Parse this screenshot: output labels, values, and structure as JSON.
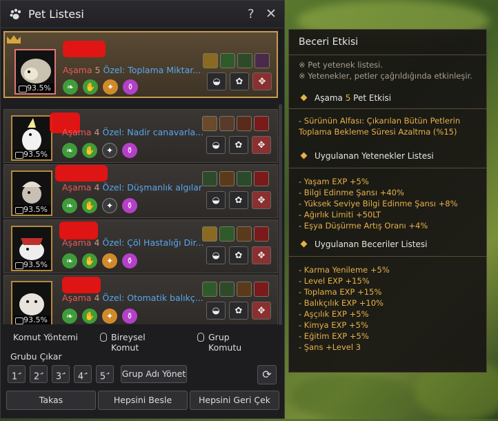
{
  "window": {
    "title": "Pet Listesi",
    "help": "?",
    "close": "✕"
  },
  "pets": [
    {
      "stage": "Aşama",
      "stage_num": "5",
      "special": "Özel: Toplama Miktar...",
      "percent": "93.5%"
    },
    {
      "stage": "Aşama",
      "stage_num": "4",
      "special": "Özel: Nadir canavarla...",
      "percent": "93.5%"
    },
    {
      "stage": "Aşama",
      "stage_num": "4",
      "special": "Özel: Düşmanlık algılar",
      "percent": "93.5%"
    },
    {
      "stage": "Aşama",
      "stage_num": "4",
      "special": "Özel: Çöl Hastalığı Dir...",
      "percent": "93.5%"
    },
    {
      "stage": "Aşama",
      "stage_num": "4",
      "special": "Özel: Otomatik balıkç...",
      "percent": "93.5%"
    }
  ],
  "footer": {
    "command_method": "Komut Yöntemi",
    "individual_command": "Bireysel Komut",
    "group_command": "Grup Komutu",
    "group_unsummon": "Grubu Çıkar",
    "group_numbers": [
      "1",
      "2",
      "3",
      "4",
      "5"
    ],
    "group_manage": "Grup Adı Yönet",
    "exchange": "Takas",
    "feed_all": "Hepsini Besle",
    "recall_all": "Hepsini Geri Çek"
  },
  "tooltip": {
    "title": "Beceri Etkisi",
    "note1": "※ Pet yetenek listesi.",
    "note2": "※ Yetenekler, petler çağrıldığında etkinleşir.",
    "stage_effect_head": "Aşama",
    "stage_effect_num": "5",
    "stage_effect_tail": "Pet Etkisi",
    "stage_effect_text": "- Sürünün Alfası: Çıkarılan Bütün Petlerin Toplama Bekleme Süresi Azaltma (%15)",
    "applied_talents_head": "Uygulanan Yetenekler Listesi",
    "talents": [
      "- Yaşam EXP +5%",
      "- Bilgi Edinme Şansı +40%",
      "- Yüksek Seviye Bilgi Edinme Şansı +8%",
      "- Ağırlık Limiti +50LT",
      "- Eşya Düşürme Artış Oranı +4%"
    ],
    "applied_skills_head": "Uygulanan Beceriler Listesi",
    "skills": [
      "- Karma Yenileme +5%",
      "- Level EXP +15%",
      "- Toplama EXP +15%",
      "- Balıkçılık EXP +10%",
      "- Aşçılık EXP +5%",
      "- Kimya EXP +5%",
      "- Eğitim EXP +5%",
      "- Şans +Level 3"
    ]
  },
  "colors": {
    "accent_gold": "#e8b04a",
    "special_blue": "#58a8ee",
    "stage_red": "#e85a5a"
  }
}
